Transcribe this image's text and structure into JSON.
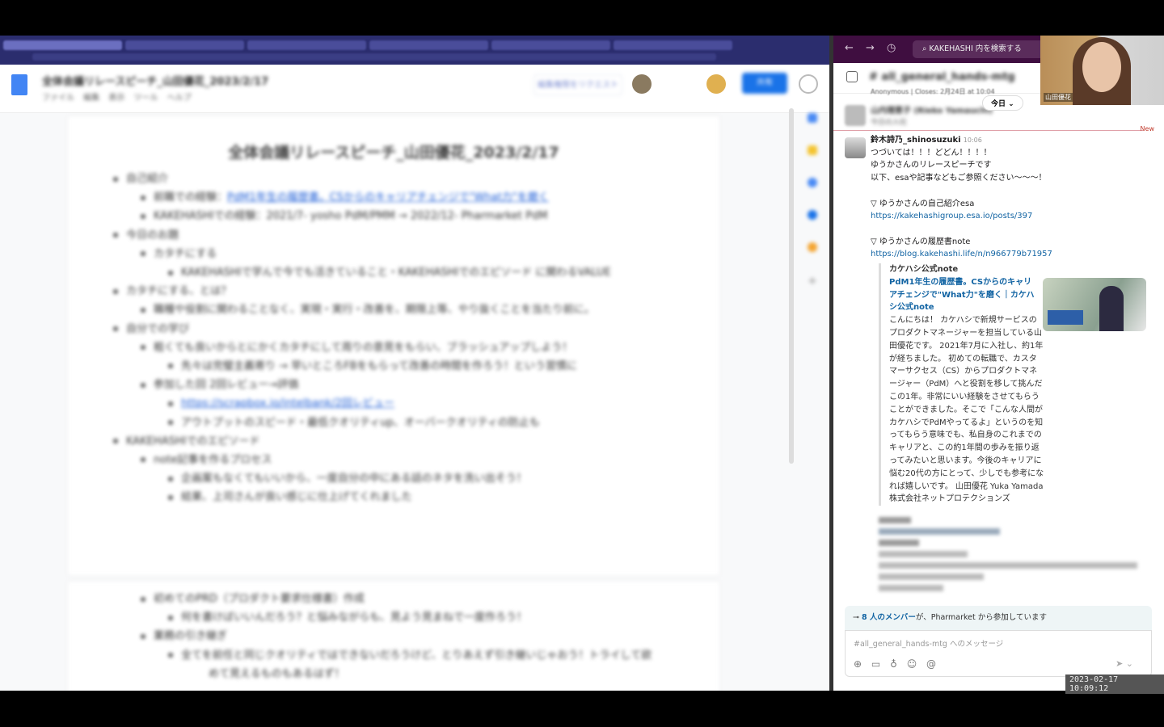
{
  "docs": {
    "title": "全体会議リレースピーチ_山田優花_2023/2/17",
    "menu": "ファイル 編集 表示 ツール ヘルプ",
    "request_button": "編集権限をリクエスト",
    "share_button": "共有",
    "page_title": "全体会議リレースピーチ_山田優花_2023/2/17",
    "lines": [
      {
        "level": 1,
        "text": "自己紹介"
      },
      {
        "level": 2,
        "text": "前職での経験：",
        "link": "PdM1年生の履歴書。CSからのキャリアチェンジで\"What力\"を磨く"
      },
      {
        "level": 2,
        "text": "KAKEHASHIでの経験：2021/7- yosho PdM/PMM → 2022/12- Pharmarket PdM"
      },
      {
        "level": 1,
        "text": "今日のお題"
      },
      {
        "level": 2,
        "text": "カタチにする"
      },
      {
        "level": 3,
        "text": "KAKEHASHIで学んで今でも活きていること・KAKEHASHIでのエピソード に関わるVALUE"
      },
      {
        "level": 1,
        "text": "カタチにする、とは？"
      },
      {
        "level": 2,
        "text": "職種や役割に関わることなく、実現・実行・改善を、期限上等、やり抜くことを当たり前に。"
      },
      {
        "level": 1,
        "text": "自分での学び"
      },
      {
        "level": 2,
        "text": "粗くても良いからとにかくカタチにして周りの意見をもらい、ブラッシュアップしよう！"
      },
      {
        "level": 3,
        "text": "先々は完璧主義寄り → 早いところFBをもらって改善の時間を作ろう！という習慣に"
      },
      {
        "level": 2,
        "text": "参加した回 2回レビュー→評価"
      },
      {
        "level": 3,
        "link": "https://scrapbox.io/intelbank/2回レビュー"
      },
      {
        "level": 3,
        "text": "アウトプットのスピード・最低クオリティup、オーバークオリティの防止も"
      },
      {
        "level": 1,
        "text": "KAKEHASHIでのエピソード"
      },
      {
        "level": 2,
        "text": "note記事を作るプロセス"
      },
      {
        "level": 3,
        "text": "企画案もなくてもいいから、一度自分の中にある話のネタを洗い出そう！"
      },
      {
        "level": 3,
        "text": "結果、上司さんが良い感じに仕上げてくれました"
      }
    ],
    "lines_page2": [
      {
        "level": 2,
        "text": "初めてのPRD（プロダクト要求仕様書）作成"
      },
      {
        "level": 3,
        "text": "何を書けばいいんだろう？と悩みながらも、見よう見まねで一度作ろう！"
      },
      {
        "level": 2,
        "text": "業務の引き継ぎ"
      },
      {
        "level": 3,
        "text": "全てを前任と同じクオリティではできないだろうけど、とりあえず引き継いじゃおう！トライして欲"
      },
      {
        "level": 4,
        "text": "めて見えるものもあるはず！"
      }
    ]
  },
  "slack": {
    "search_placeholder": "KAKEHASHI 内を検索する",
    "channel_name": "# all_general_hands-mtg",
    "prev_meta": "Anonymous | Closes: 2月24日 at 10:04",
    "prev_author": "山内理恵子 (Rieko Yamauchi)",
    "prev_text": "今日の入社",
    "date_pill": "今日",
    "new_label": "New",
    "message": {
      "author": "鈴木詩乃_shinosuzuki",
      "time": "10:06",
      "lines": [
        "つづいては！！！どどん！！！！",
        "ゆうかさんのリレースピーチです",
        "以下、esaや記事などもご参照ください〜〜〜！"
      ],
      "esa_label": "▽ ゆうかさんの自己紹介esa",
      "esa_link": "https://kakehashigroup.esa.io/posts/397",
      "note_label": "▽ ゆうかさんの履歴書note",
      "note_link": "https://blog.kakehashi.life/n/n966779b71957"
    },
    "attachment": {
      "source": "カケハシ公式note",
      "title": "PdM1年生の履歴書。CSからのキャリアチェンジで\"What力\"を磨く｜カケハシ公式note",
      "description": "こんにちは！ カケハシで新規サービスのプロダクトマネージャーを担当している山田優花です。 2021年7月に入社し、約1年が経ちました。 初めての転職で、カスタマーサクセス（CS）からプロダクトマネージャー（PdM）へと役割を移して挑んだこの1年。非常にいい経験をさせてもらうことができました。そこで「こんな人間がカケハシでPdMやってるよ」というのを知ってもらう意味でも、私自身のこれまでのキャリアと、この約1年間の歩みを振り返ってみたいと思います。今後のキャリアに悩む20代の方にとって、少しでも参考になれば嬉しいです。 山田優花 Yuka Yamada 株式会社ネットプロテクションズ"
    },
    "banner_bold": "8 人のメンバー",
    "banner_rest": "が、Pharmarket から参加しています",
    "composer_placeholder": "#all_general_hands-mtg へのメッセージ"
  },
  "video": {
    "name": "山田優花"
  },
  "timestamp": "2023-02-17 10:09:12"
}
